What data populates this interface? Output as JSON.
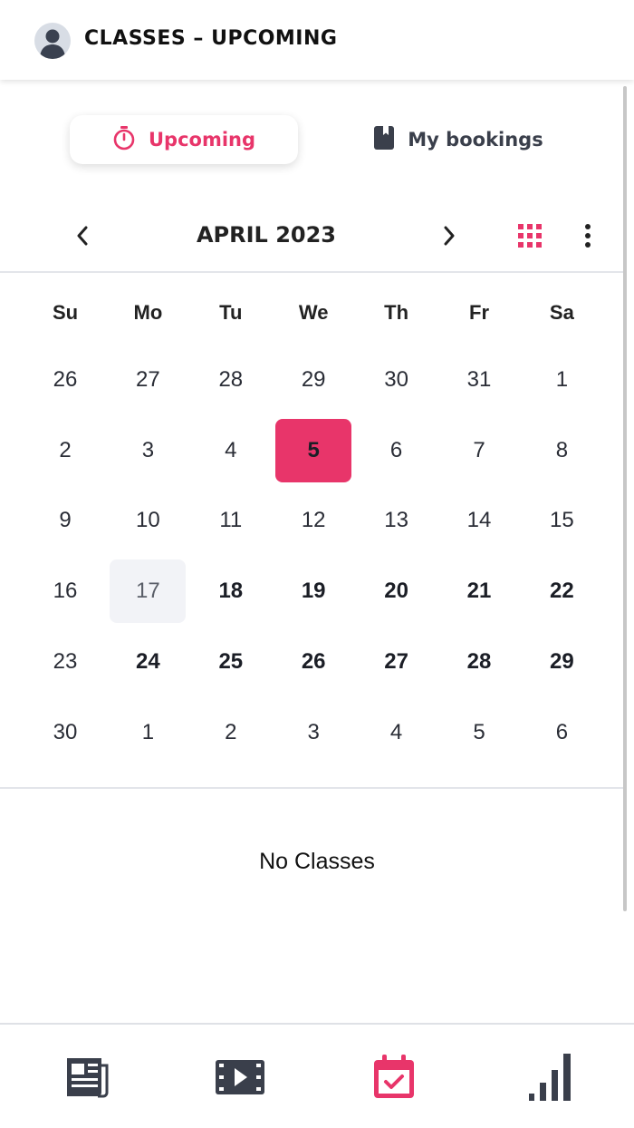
{
  "header": {
    "title": "CLASSES – UPCOMING",
    "avatar_icon": "user-avatar-icon"
  },
  "tabs": {
    "upcoming": {
      "label": "Upcoming",
      "icon": "stopwatch-icon",
      "active": true
    },
    "bookings": {
      "label": "My bookings",
      "icon": "bookmark-icon",
      "active": false
    }
  },
  "calendar": {
    "month_label": "APRIL 2023",
    "prev_icon": "chevron-left-icon",
    "next_icon": "chevron-right-icon",
    "view_icon": "grid-view-icon",
    "more_icon": "more-vertical-icon",
    "weekdays": [
      "Su",
      "Mo",
      "Tu",
      "We",
      "Th",
      "Fr",
      "Sa"
    ],
    "weeks": [
      [
        "26",
        "27",
        "28",
        "29",
        "30",
        "31",
        "1"
      ],
      [
        "2",
        "3",
        "4",
        "5",
        "6",
        "7",
        "8"
      ],
      [
        "9",
        "10",
        "11",
        "12",
        "13",
        "14",
        "15"
      ],
      [
        "16",
        "17",
        "18",
        "19",
        "20",
        "21",
        "22"
      ],
      [
        "23",
        "24",
        "25",
        "26",
        "27",
        "28",
        "29"
      ],
      [
        "30",
        "1",
        "2",
        "3",
        "4",
        "5",
        "6"
      ]
    ],
    "selected_day": "5",
    "highlighted_day": "17",
    "bold_days": [
      "18",
      "19",
      "20",
      "21",
      "22",
      "24",
      "25",
      "26",
      "27",
      "28",
      "29"
    ]
  },
  "empty_state": "No Classes",
  "bottom_nav": [
    {
      "icon": "newspaper-icon",
      "active": false
    },
    {
      "icon": "video-icon",
      "active": false
    },
    {
      "icon": "calendar-check-icon",
      "active": true
    },
    {
      "icon": "bar-chart-icon",
      "active": false
    }
  ],
  "colors": {
    "accent": "#e8356a",
    "icon_dark": "#3a3f4b",
    "highlight": "#f2f3f7"
  }
}
